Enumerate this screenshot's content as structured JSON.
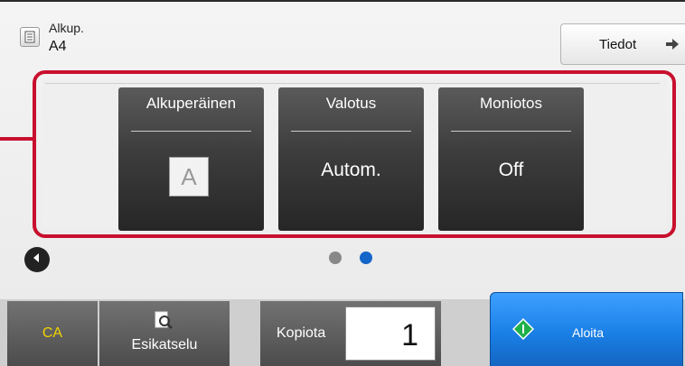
{
  "header": {
    "original_label": "Alkup.",
    "original_size": "A4",
    "info_button": "Tiedot"
  },
  "keys": [
    {
      "title": "Alkuperäinen",
      "value": "A"
    },
    {
      "title": "Valotus",
      "value": "Autom."
    },
    {
      "title": "Moniotos",
      "value": "Off"
    }
  ],
  "pagination": {
    "pages": 2,
    "current": 2
  },
  "bottom": {
    "ca_label": "CA",
    "preview_label": "Esikatselu",
    "copies_label": "Kopiota",
    "copies_value": "1",
    "start_label": "Aloita"
  },
  "colors": {
    "highlight": "#c8102e",
    "start_button": "#1a7fe6",
    "ca_text": "#f2d300",
    "active_dot": "#1466c8"
  },
  "icons": [
    "document-icon",
    "arrow-right-icon",
    "prev-arrow-icon",
    "preview-magnifier-icon",
    "start-diamond-icon"
  ]
}
